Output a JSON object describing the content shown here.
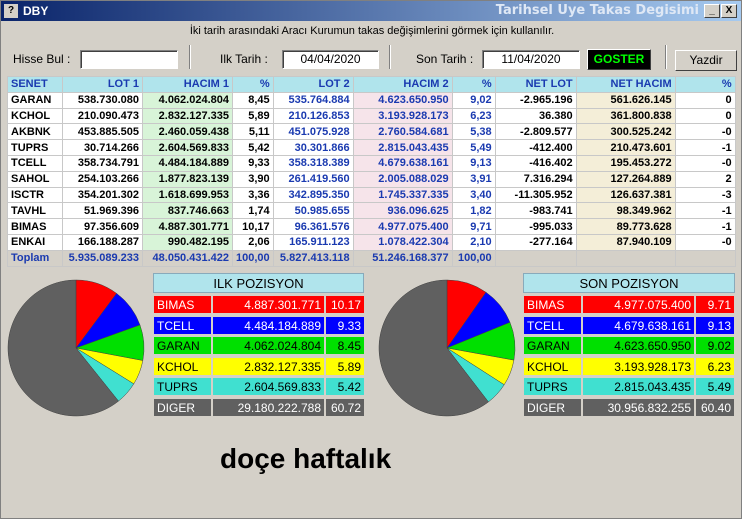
{
  "window": {
    "app": "DBY",
    "title_right": "Tarihsel Uye Takas Degisimi",
    "minimize": "_",
    "close": "X"
  },
  "hint": "İki tarih arasındaki  Aracı Kurumun takas değişimlerini görmek için kullanılır.",
  "search": {
    "label": "Hisse Bul :",
    "value": ""
  },
  "start": {
    "label": "Ilk Tarih :",
    "value": "04/04/2020"
  },
  "end": {
    "label": "Son Tarih :",
    "value": "11/04/2020"
  },
  "goster": "GOSTER",
  "yazdir": "Yazdir",
  "columns": [
    "SENET",
    "LOT 1",
    "HACIM 1",
    "%",
    "LOT 2",
    "HACIM 2",
    "%",
    "NET LOT",
    "NET HACIM",
    "%"
  ],
  "rows": [
    [
      "GARAN",
      "538.730.080",
      "4.062.024.804",
      "8,45",
      "535.764.884",
      "4.623.650.950",
      "9,02",
      "-2.965.196",
      "561.626.145",
      "0"
    ],
    [
      "KCHOL",
      "210.090.473",
      "2.832.127.335",
      "5,89",
      "210.126.853",
      "3.193.928.173",
      "6,23",
      "36.380",
      "361.800.838",
      "0"
    ],
    [
      "AKBNK",
      "453.885.505",
      "2.460.059.438",
      "5,11",
      "451.075.928",
      "2.760.584.681",
      "5,38",
      "-2.809.577",
      "300.525.242",
      "-0"
    ],
    [
      "TUPRS",
      "30.714.266",
      "2.604.569.833",
      "5,42",
      "30.301.866",
      "2.815.043.435",
      "5,49",
      "-412.400",
      "210.473.601",
      "-1"
    ],
    [
      "TCELL",
      "358.734.791",
      "4.484.184.889",
      "9,33",
      "358.318.389",
      "4.679.638.161",
      "9,13",
      "-416.402",
      "195.453.272",
      "-0"
    ],
    [
      "SAHOL",
      "254.103.266",
      "1.877.823.139",
      "3,90",
      "261.419.560",
      "2.005.088.029",
      "3,91",
      "7.316.294",
      "127.264.889",
      "2"
    ],
    [
      "ISCTR",
      "354.201.302",
      "1.618.699.953",
      "3,36",
      "342.895.350",
      "1.745.337.335",
      "3,40",
      "-11.305.952",
      "126.637.381",
      "-3"
    ],
    [
      "TAVHL",
      "51.969.396",
      "837.746.663",
      "1,74",
      "50.985.655",
      "936.096.625",
      "1,82",
      "-983.741",
      "98.349.962",
      "-1"
    ],
    [
      "BIMAS",
      "97.356.609",
      "4.887.301.771",
      "10,17",
      "96.361.576",
      "4.977.075.400",
      "9,71",
      "-995.033",
      "89.773.628",
      "-1"
    ],
    [
      "ENKAI",
      "166.188.287",
      "990.482.195",
      "2,06",
      "165.911.123",
      "1.078.422.304",
      "2,10",
      "-277.164",
      "87.940.109",
      "-0"
    ]
  ],
  "total": [
    "Toplam",
    "5.935.089.233",
    "48.050.431.422",
    "100,00",
    "5.827.413.118",
    "51.246.168.377",
    "100,00",
    "",
    "",
    ""
  ],
  "ilk": {
    "title": "ILK POZISYON",
    "items": [
      {
        "name": "BIMAS",
        "value": "4.887.301.771",
        "pct": "10.17",
        "frac": 0.1017,
        "color": "#ff0000",
        "text": "#fff"
      },
      {
        "name": "TCELL",
        "value": "4.484.184.889",
        "pct": "9.33",
        "frac": 0.0933,
        "color": "#0000ff",
        "text": "#fff"
      },
      {
        "name": "GARAN",
        "value": "4.062.024.804",
        "pct": "8.45",
        "frac": 0.0845,
        "color": "#00e000",
        "text": "#000"
      },
      {
        "name": "KCHOL",
        "value": "2.832.127.335",
        "pct": "5.89",
        "frac": 0.0589,
        "color": "#ffff00",
        "text": "#000"
      },
      {
        "name": "TUPRS",
        "value": "2.604.569.833",
        "pct": "5.42",
        "frac": 0.0542,
        "color": "#40e0d0",
        "text": "#000"
      },
      {
        "name": "DIGER",
        "value": "29.180.222.788",
        "pct": "60.72",
        "frac": 0.6072,
        "color": "#606060",
        "text": "#fff"
      }
    ]
  },
  "son": {
    "title": "SON POZISYON",
    "items": [
      {
        "name": "BIMAS",
        "value": "4.977.075.400",
        "pct": "9.71",
        "frac": 0.0971,
        "color": "#ff0000",
        "text": "#fff"
      },
      {
        "name": "TCELL",
        "value": "4.679.638.161",
        "pct": "9.13",
        "frac": 0.0913,
        "color": "#0000ff",
        "text": "#fff"
      },
      {
        "name": "GARAN",
        "value": "4.623.650.950",
        "pct": "9.02",
        "frac": 0.0902,
        "color": "#00e000",
        "text": "#000"
      },
      {
        "name": "KCHOL",
        "value": "3.193.928.173",
        "pct": "6.23",
        "frac": 0.0623,
        "color": "#ffff00",
        "text": "#000"
      },
      {
        "name": "TUPRS",
        "value": "2.815.043.435",
        "pct": "5.49",
        "frac": 0.0549,
        "color": "#40e0d0",
        "text": "#000"
      },
      {
        "name": "DIGER",
        "value": "30.956.832.255",
        "pct": "60.40",
        "frac": 0.604,
        "color": "#606060",
        "text": "#fff"
      }
    ]
  },
  "caption": "doçe haftalık"
}
